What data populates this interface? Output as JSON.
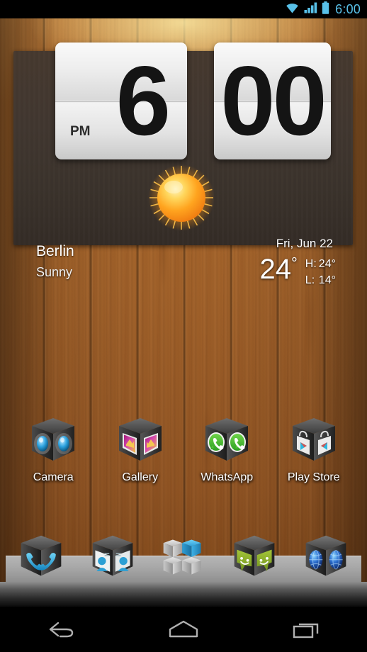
{
  "status_bar": {
    "time": "6:00",
    "icons": [
      "wifi-icon",
      "cellular-signal-icon",
      "battery-icon"
    ],
    "accent_color": "#58c0e8"
  },
  "widget": {
    "type": "flip-clock-weather-widget",
    "clock": {
      "hour": "6",
      "minute": "00",
      "meridiem": "PM"
    },
    "weather": {
      "city": "Berlin",
      "condition": "Sunny",
      "condition_icon": "sun-icon",
      "date": "Fri, Jun 22",
      "temperature": "24",
      "degree": "°",
      "high_key": "H:",
      "high_value": "24°",
      "low_key": "L:",
      "low_value": "14°"
    },
    "panel_color": "#3d342e"
  },
  "app_grid": [
    {
      "label": "Camera",
      "icon": "camera-icon"
    },
    {
      "label": "Gallery",
      "icon": "gallery-icon"
    },
    {
      "label": "WhatsApp",
      "icon": "whatsapp-icon"
    },
    {
      "label": "Play Store",
      "icon": "play-store-icon"
    }
  ],
  "dock": [
    {
      "name": "phone-icon",
      "label": "Phone"
    },
    {
      "name": "contacts-icon",
      "label": "Contacts"
    },
    {
      "name": "app-drawer-icon",
      "label": "Apps"
    },
    {
      "name": "messaging-icon",
      "label": "Messaging"
    },
    {
      "name": "browser-icon",
      "label": "Browser"
    }
  ],
  "nav_bar": [
    {
      "name": "back-button",
      "label": "Back"
    },
    {
      "name": "home-button",
      "label": "Home"
    },
    {
      "name": "recents-button",
      "label": "Recent apps"
    }
  ]
}
